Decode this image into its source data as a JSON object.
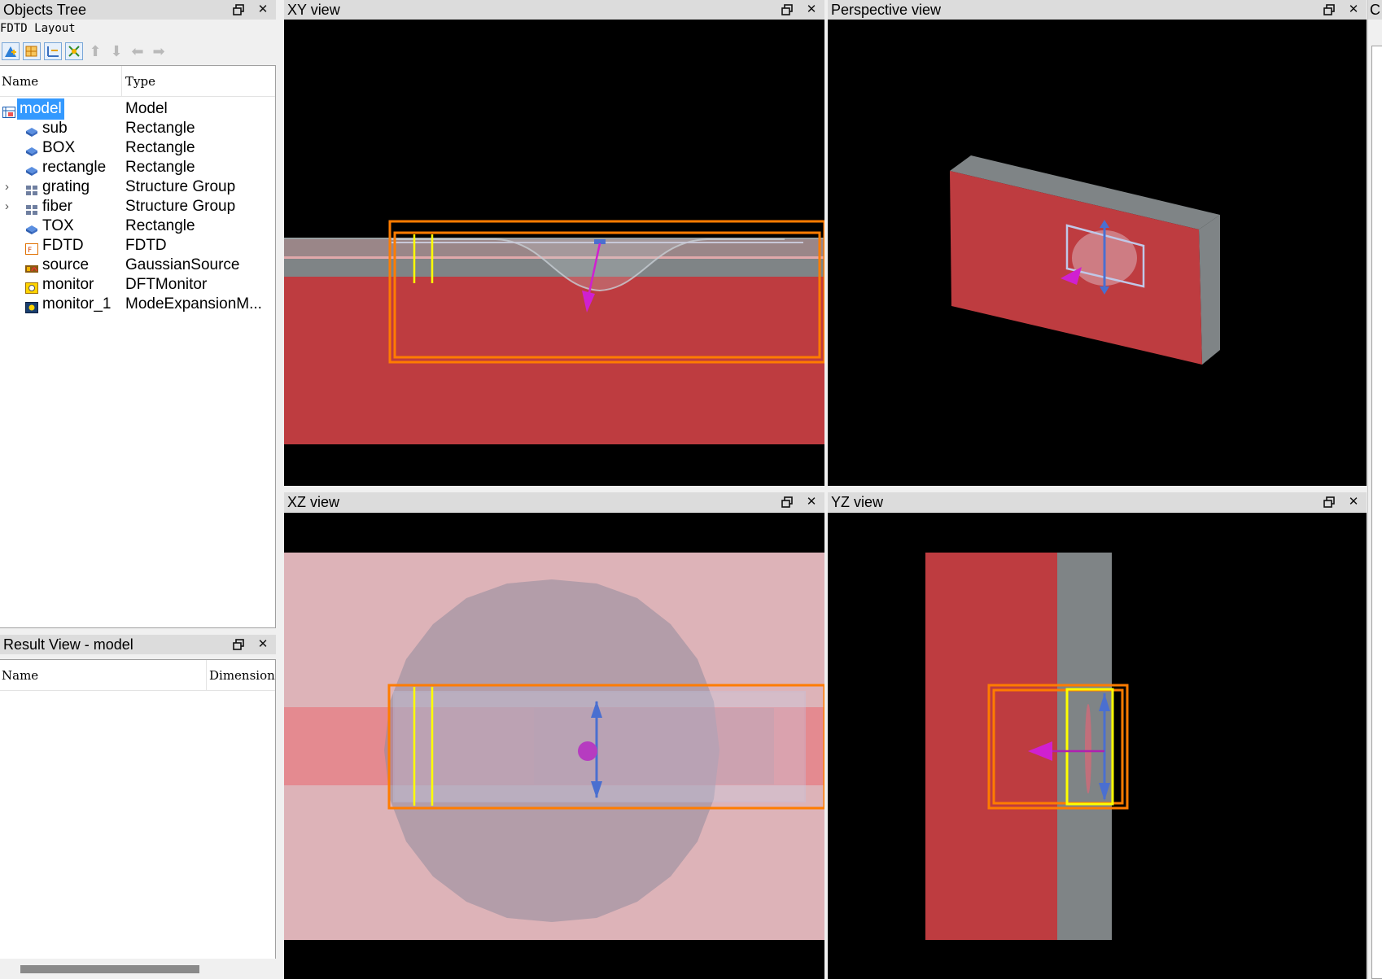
{
  "objects_tree": {
    "title": "Objects Tree",
    "subtitle": "FDTD Layout",
    "col_name": "Name",
    "col_type": "Type",
    "items": [
      {
        "name": "model",
        "type": "Model",
        "icon": "model-icon",
        "expandable": false,
        "selected": true
      },
      {
        "name": "sub",
        "type": "Rectangle",
        "icon": "rectangle-icon",
        "expandable": false
      },
      {
        "name": "BOX",
        "type": "Rectangle",
        "icon": "rectangle-icon",
        "expandable": false
      },
      {
        "name": "rectangle",
        "type": "Rectangle",
        "icon": "rectangle-icon",
        "expandable": false
      },
      {
        "name": "grating",
        "type": "Structure Group",
        "icon": "structure-group-icon",
        "expandable": true
      },
      {
        "name": "fiber",
        "type": "Structure Group",
        "icon": "structure-group-icon",
        "expandable": true
      },
      {
        "name": "TOX",
        "type": "Rectangle",
        "icon": "rectangle-icon",
        "expandable": false
      },
      {
        "name": "FDTD",
        "type": "FDTD",
        "icon": "fdtd-icon",
        "expandable": false
      },
      {
        "name": "source",
        "type": "GaussianSource",
        "icon": "source-icon",
        "expandable": false
      },
      {
        "name": "monitor",
        "type": "DFTMonitor",
        "icon": "monitor-icon",
        "expandable": false
      },
      {
        "name": "monitor_1",
        "type": "ModeExpansionM...",
        "icon": "mode-monitor-icon",
        "expandable": false
      }
    ]
  },
  "result_view": {
    "title": "Result View - model",
    "col_name": "Name",
    "col_dimension": "Dimension"
  },
  "views": {
    "xy": "XY view",
    "perspective": "Perspective view",
    "xz": "XZ view",
    "yz": "YZ view"
  },
  "right_panel_title": "C",
  "colors": {
    "substrate_red": "#be3c40",
    "oxide_gray": "#7f8486",
    "fdtd_orange": "#ff7c00",
    "source_magenta": "#d020d0",
    "monitor_yellow": "#ffff00",
    "arrow_blue": "#4a6fd0",
    "selection_blue": "#3399ff",
    "xz_pink": "#ddb3b8"
  }
}
